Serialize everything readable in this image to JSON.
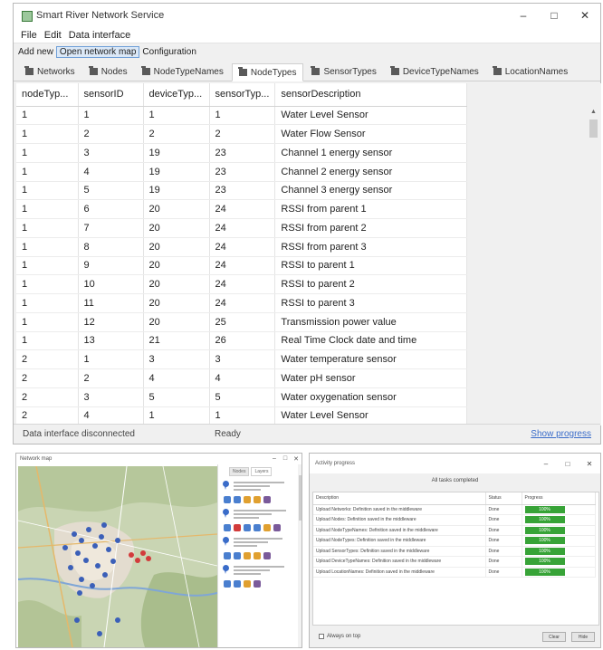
{
  "main_window": {
    "title": "Smart River Network Service",
    "window_controls": {
      "minimize": "–",
      "maximize": "□",
      "close": "✕"
    },
    "menu": [
      "File",
      "Edit",
      "Data interface"
    ],
    "links": [
      "Add new",
      "Open network map",
      "Configuration"
    ],
    "tabs": [
      "Networks",
      "Nodes",
      "NodeTypeNames",
      "NodeTypes",
      "SensorTypes",
      "DeviceTypeNames",
      "LocationNames"
    ],
    "active_tab": "NodeTypes",
    "table": {
      "columns": [
        "nodeTyp...",
        "sensorID",
        "deviceTyp...",
        "sensorTyp...",
        "sensorDescription"
      ],
      "rows": [
        [
          "1",
          "1",
          "1",
          "1",
          "Water Level Sensor"
        ],
        [
          "1",
          "2",
          "2",
          "2",
          "Water Flow Sensor"
        ],
        [
          "1",
          "3",
          "19",
          "23",
          "Channel 1 energy sensor"
        ],
        [
          "1",
          "4",
          "19",
          "23",
          "Channel 2 energy sensor"
        ],
        [
          "1",
          "5",
          "19",
          "23",
          "Channel 3 energy sensor"
        ],
        [
          "1",
          "6",
          "20",
          "24",
          "RSSI from parent 1"
        ],
        [
          "1",
          "7",
          "20",
          "24",
          "RSSI from parent 2"
        ],
        [
          "1",
          "8",
          "20",
          "24",
          "RSSI from parent 3"
        ],
        [
          "1",
          "9",
          "20",
          "24",
          "RSSI to parent 1"
        ],
        [
          "1",
          "10",
          "20",
          "24",
          "RSSI to parent 2"
        ],
        [
          "1",
          "11",
          "20",
          "24",
          "RSSI to parent 3"
        ],
        [
          "1",
          "12",
          "20",
          "25",
          "Transmission power value"
        ],
        [
          "1",
          "13",
          "21",
          "26",
          "Real Time Clock date and time"
        ],
        [
          "2",
          "1",
          "3",
          "3",
          "Water temperature sensor"
        ],
        [
          "2",
          "2",
          "4",
          "4",
          "Water pH sensor"
        ],
        [
          "2",
          "3",
          "5",
          "5",
          "Water oxygenation sensor"
        ],
        [
          "2",
          "4",
          "1",
          "1",
          "Water Level Sensor"
        ]
      ]
    },
    "status": {
      "connection": "Data interface disconnected",
      "state": "Ready",
      "link": "Show progress"
    }
  },
  "map_window": {
    "title": "Network map",
    "side_tabs": [
      "Nodes",
      "Layers"
    ]
  },
  "progress_window": {
    "title": "Activity progress",
    "summary": "All tasks completed",
    "columns": [
      "Description",
      "Status",
      "Progress"
    ],
    "rows": [
      {
        "description": "Upload Networks: Definition saved in the middleware",
        "status": "Done",
        "progress": "100%"
      },
      {
        "description": "Upload Nodes: Definition saved in the middleware",
        "status": "Done",
        "progress": "100%"
      },
      {
        "description": "Upload NodeTypeNames: Definition saved in the middleware",
        "status": "Done",
        "progress": "100%"
      },
      {
        "description": "Upload NodeTypes: Definition saved in the middleware",
        "status": "Done",
        "progress": "100%"
      },
      {
        "description": "Upload SensorTypes: Definition saved in the middleware",
        "status": "Done",
        "progress": "100%"
      },
      {
        "description": "Upload DeviceTypeNames: Definition saved in the middleware",
        "status": "Done",
        "progress": "100%"
      },
      {
        "description": "Upload LocationNames: Definition saved in the middleware",
        "status": "Done",
        "progress": "100%"
      }
    ],
    "checkbox_label": "Always on top",
    "buttons": [
      "Clear",
      "Hide"
    ],
    "progress_color": "#37a337"
  }
}
